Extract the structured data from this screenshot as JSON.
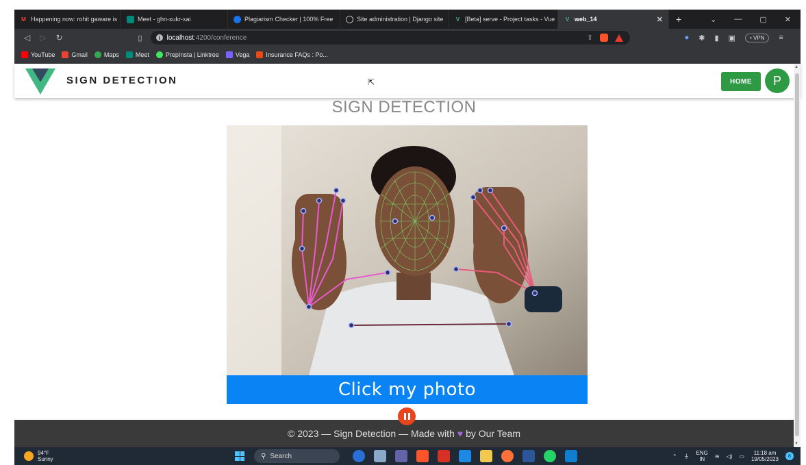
{
  "browser": {
    "tabs": [
      {
        "label": "Happening now: rohit gaware is",
        "color": "#ea4335",
        "icon": "gmail-icon"
      },
      {
        "label": "Meet - ghn-xukr-xai",
        "color": "#00897b",
        "icon": "meet-icon"
      },
      {
        "label": "Plagiarism Checker | 100% Free",
        "color": "#1a73e8",
        "icon": "plagiarism-icon"
      },
      {
        "label": "Site administration | Django site",
        "color": "#888888",
        "icon": "django-icon"
      },
      {
        "label": "[Beta] serve - Project tasks - Vue",
        "color": "#41b883",
        "icon": "vue-icon"
      },
      {
        "label": "web_14",
        "color": "#41b883",
        "icon": "vue-icon"
      }
    ],
    "active_tab_index": 5,
    "new_tab": "+",
    "url_host": "localhost",
    "url_path": ":4200/conference",
    "vpn_label": "• VPN",
    "bookmarks": [
      {
        "label": "YouTube",
        "color": "#ff0000"
      },
      {
        "label": "Gmail",
        "color": "#ea4335"
      },
      {
        "label": "Maps",
        "color": "#34a853"
      },
      {
        "label": "Meet",
        "color": "#00897b"
      },
      {
        "label": "PrepInsta | Linktree",
        "color": "#43e660"
      },
      {
        "label": "Vega",
        "color": "#7b61ff"
      },
      {
        "label": "Insurance FAQs : Po...",
        "color": "#e64a19"
      }
    ]
  },
  "app": {
    "brand": "SIGN DETECTION",
    "home_label": "HOME",
    "avatar_initial": "P",
    "page_title": "SIGN DETECTION",
    "capture_label": "Click my photo",
    "footer": {
      "copyright": "© 2023 — Sign Detection — Made with",
      "heart": "♥",
      "by": "by Our Team"
    },
    "accent": "#2e9a44",
    "capture_color": "#0a84f5"
  },
  "taskbar": {
    "temperature": "94°F",
    "condition": "Sunny",
    "search_placeholder": "Search",
    "language_top": "ENG",
    "language_bottom": "IN",
    "time": "11:18 am",
    "date": "19/05/2023",
    "notification_count": "8"
  }
}
